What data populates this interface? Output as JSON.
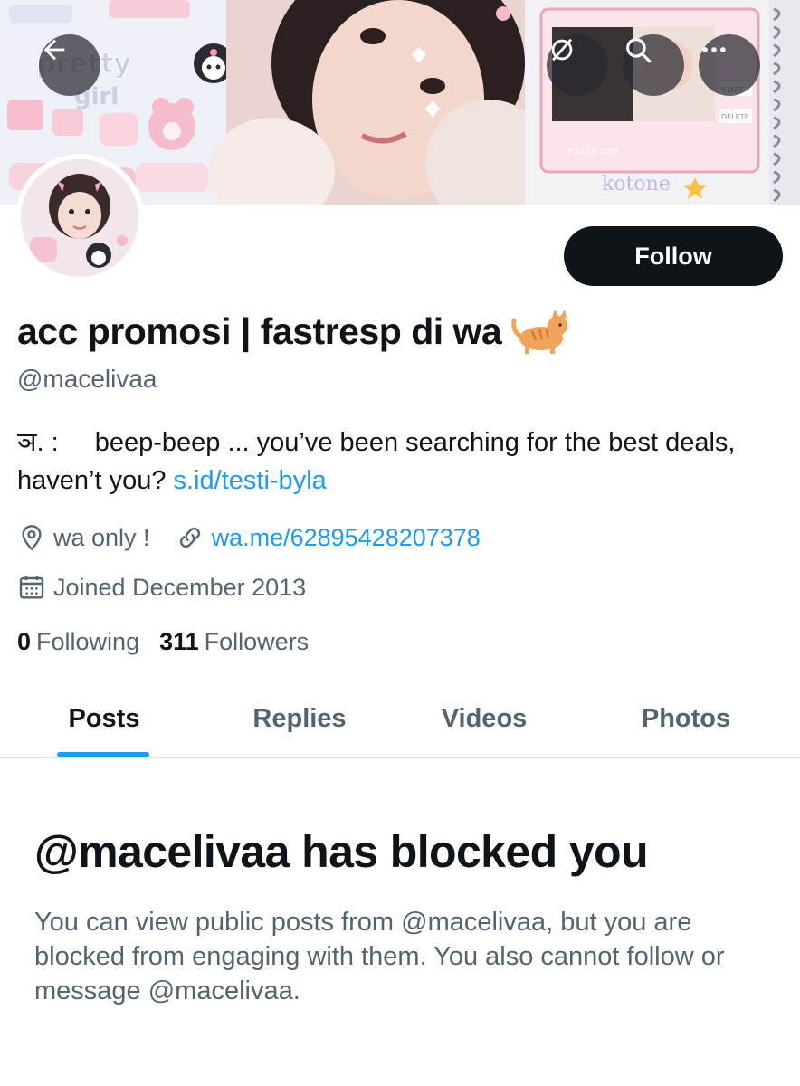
{
  "header": {
    "back_icon": "arrow-left-icon",
    "refresh_icon": "refresh-off-icon",
    "search_icon": "search-icon",
    "more_icon": "more-horizontal-icon",
    "banner_text": {
      "pretty_girl": "pretty girl",
      "kotone": "kotone",
      "start": "START",
      "delete": "DELETE",
      "full_of_love": "FULL OF LOVE"
    }
  },
  "profile": {
    "display_name": "acc promosi | fastresp di wa",
    "name_emoji": "cat-emoji",
    "handle": "@macelivaa",
    "follow_label": "Follow",
    "bio_prefix": "ञ. :",
    "bio_text": "beep-beep ... you’ve been searching for the best deals, haven’t you?",
    "bio_link": "s.id/testi-byla",
    "location": "wa only !",
    "website": "wa.me/62895428207378",
    "joined": "Joined December 2013",
    "following_count": "0",
    "following_label": "Following",
    "followers_count": "311",
    "followers_label": "Followers"
  },
  "tabs": [
    {
      "label": "Posts",
      "active": true
    },
    {
      "label": "Replies",
      "active": false
    },
    {
      "label": "Videos",
      "active": false
    },
    {
      "label": "Photos",
      "active": false
    }
  ],
  "blocked": {
    "title": "@macelivaa has blocked you",
    "message": "You can view public posts from @macelivaa, but you are blocked from engaging with them. You also cannot follow or message @macelivaa."
  },
  "colors": {
    "accent": "#1d9bf0",
    "text_primary": "#0f1419",
    "text_secondary": "#536471",
    "button_dark": "#0f1419"
  }
}
